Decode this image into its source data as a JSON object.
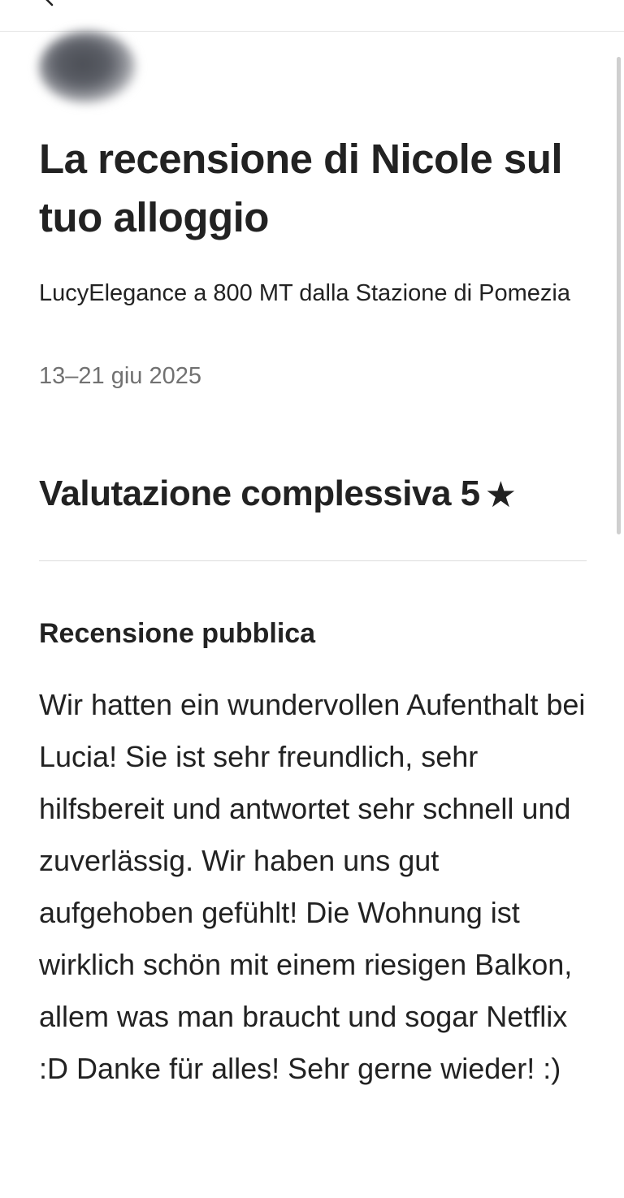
{
  "review": {
    "title": "La recensione di Nicole sul tuo alloggio",
    "listing_name": "LucyElegance a 800 MT dalla Stazione di Pomezia",
    "dates": "13–21 giu 2025",
    "overall_label": "Valutazione complessiva 5",
    "star_icon": "★",
    "rating_value": 5,
    "public_review_heading": "Recensione pubblica",
    "public_review_text": "Wir hatten ein wundervollen Aufenthalt bei Lucia! Sie ist sehr freundlich, sehr hilfsbereit und antwortet sehr schnell und zuverlässig. Wir haben uns gut aufgehoben gefühlt! Die Wohnung ist wirklich schön mit einem riesigen Balkon, allem was man braucht und sogar Netflix :D Danke für alles! Sehr gerne wieder! :)"
  },
  "icons": {
    "back": "arrow-left-icon",
    "avatar": "avatar",
    "star": "star-icon"
  },
  "colors": {
    "text_primary": "#222222",
    "text_secondary": "#717171",
    "divider": "#dddddd"
  }
}
